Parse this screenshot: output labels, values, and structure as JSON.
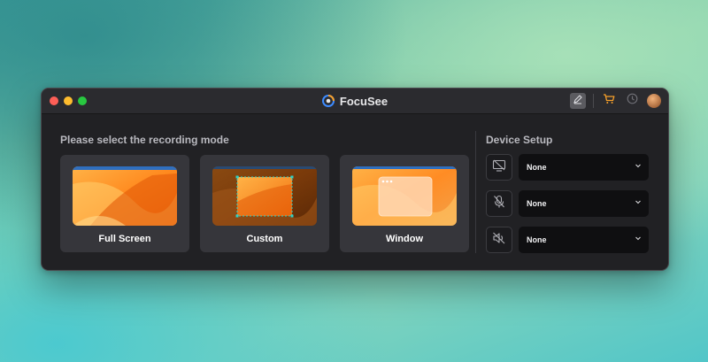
{
  "window": {
    "title": "FocuSee"
  },
  "toolbar": {
    "icons": [
      "edit-icon",
      "cart-icon",
      "clock-icon",
      "avatar"
    ]
  },
  "recording": {
    "heading": "Please select the recording mode",
    "modes": [
      {
        "label": "Full Screen"
      },
      {
        "label": "Custom"
      },
      {
        "label": "Window"
      }
    ]
  },
  "device": {
    "heading": "Device Setup",
    "rows": [
      {
        "icon": "screen-off-icon",
        "value": "None"
      },
      {
        "icon": "microphone-off-icon",
        "value": "None"
      },
      {
        "icon": "speaker-muted-icon",
        "value": "None"
      }
    ]
  },
  "colors": {
    "accent_orange": "#f7a02a",
    "selection_cyan": "#2fd3c8",
    "window_bg": "#212124",
    "card_bg": "#36363b"
  }
}
